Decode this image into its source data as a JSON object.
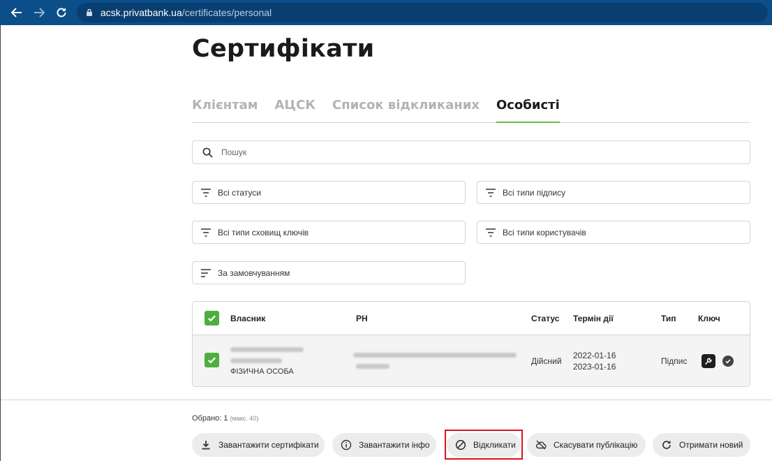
{
  "browser": {
    "url_host": "acsk.privatbank.ua",
    "url_path": "/certificates/personal"
  },
  "page": {
    "title": "Сертифікати"
  },
  "tabs": [
    {
      "label": "Клієнтам",
      "active": false
    },
    {
      "label": "АЦСК",
      "active": false
    },
    {
      "label": "Список відкликаних",
      "active": false
    },
    {
      "label": "Особисті",
      "active": true
    }
  ],
  "search": {
    "placeholder": "Пошук"
  },
  "filters": {
    "statuses": "Всі статуси",
    "sign_types": "Всі типи підпису",
    "key_storages": "Всі типи сховищ ключів",
    "users": "Всі типи користувачів",
    "sort": "За замовчуванням"
  },
  "table": {
    "headers": {
      "owner": "Власник",
      "rn": "РН",
      "status": "Статус",
      "validity": "Термін дії",
      "type": "Тип",
      "key": "Ключ"
    },
    "rows": [
      {
        "selected": true,
        "owner_type": "ФІЗИЧНА ОСОБА",
        "status": "Дійсний",
        "valid_from": "2022-01-16",
        "valid_to": "2023-01-16",
        "type": "Підпис"
      }
    ]
  },
  "footer": {
    "selected_label": "Обрано: 1",
    "selected_max": "(макс. 40)",
    "actions": {
      "download_certs": "Завантажити сертифікати",
      "download_info": "Завантажити інфо",
      "revoke": "Відкликати",
      "cancel_publication": "Скасувати публікацію",
      "get_new": "Отримати новий"
    }
  },
  "colors": {
    "accent_green": "#4caf3e",
    "tab_underline": "#6cbb3c",
    "highlight_red": "#d9141e",
    "chrome_blue": "#0b4e8a"
  }
}
